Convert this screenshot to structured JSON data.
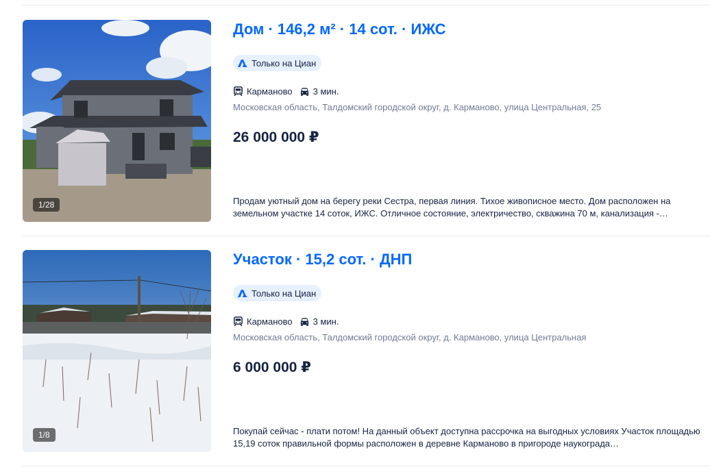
{
  "listings": [
    {
      "title": "Дом · 146,2 м² · 14 сот. · ИЖС",
      "badge": "Только на Циан",
      "station": "Карманово",
      "travel_time": "3 мин.",
      "address": "Московская область, Талдомский городской округ, д. Карманово, улица Центральная, 25",
      "price": "26 000 000 ₽",
      "description": "Продам уютный дом на берегу реки Сестра, первая линия. Тихое живописное место. Дом расположен на земельном участке 14 соток, ИЖС. Отличное состояние, электричество, скважина 70 м, канализация -…",
      "photo_counter": "1/28"
    },
    {
      "title": "Участок · 15,2 сот. · ДНП",
      "badge": "Только на Циан",
      "station": "Карманово",
      "travel_time": "3 мин.",
      "address": "Московская область, Талдомский городской округ, д. Карманово, улица Центральная",
      "price": "6 000 000 ₽",
      "description": "Покупай сейчас - плати потом! На данный объект доступна рассрочка на выгодных условиях Участок площадью 15,19 соток правильной формы расположен в деревне Карманово в пригороде наукограда…",
      "photo_counter": "1/8"
    }
  ],
  "colors": {
    "link": "#0468ff",
    "text": "#152242",
    "muted": "#707a95",
    "badge_bg": "#e7f0ff"
  }
}
